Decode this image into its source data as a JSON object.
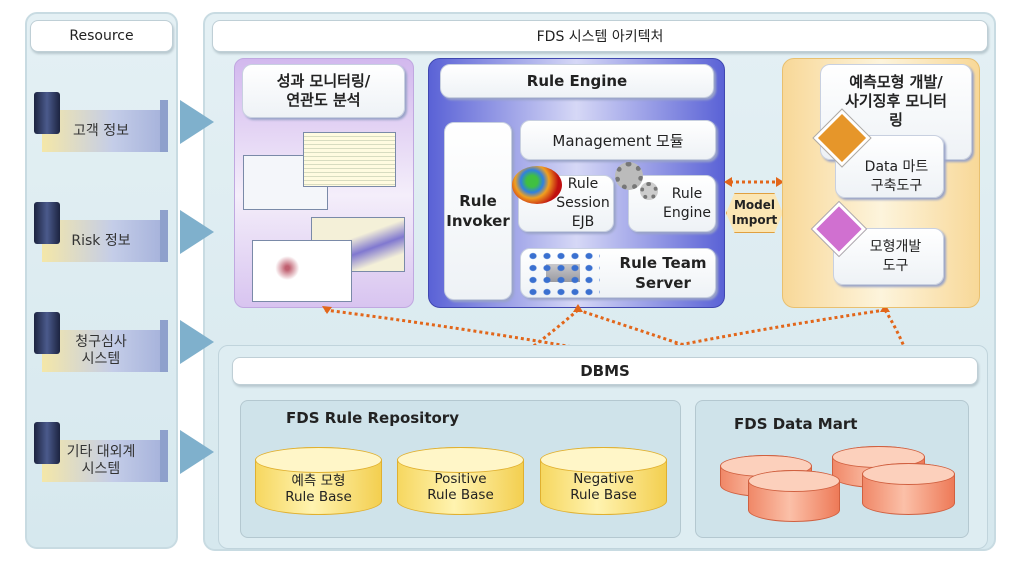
{
  "resource": {
    "title": "Resource",
    "items": [
      {
        "label": "고객 정보",
        "icon": "server-icon"
      },
      {
        "label": "Risk 정보",
        "icon": "server-icon"
      },
      {
        "label": "청구심사\n시스템",
        "icon": "server-icon"
      },
      {
        "label": "기타 대외계\n시스템",
        "icon": "server-icon"
      }
    ]
  },
  "main": {
    "title": "FDS 시스템 아키텍처"
  },
  "monitoring": {
    "title": "성과 모니터링/\n연관도 분석"
  },
  "rule_engine": {
    "title": "Rule Engine",
    "invoker": "Rule\nInvoker",
    "management": "Management 모듈",
    "session": "Rule\nSession\nEJB",
    "engine": "Rule\nEngine",
    "team_server": "Rule Team\nServer"
  },
  "model_import": "Model\nImport",
  "predict": {
    "title": "예측모형 개발/\n사기징후 모니터\n링",
    "datamart_tool": "Data 마트\n구축도구",
    "model_tool": "모형개발\n도구"
  },
  "dbms": {
    "title": "DBMS",
    "repository": {
      "title": "FDS Rule Repository",
      "bases": [
        "예측 모형\nRule Base",
        "Positive\nRule Base",
        "Negative\nRule Base"
      ]
    },
    "datamart": {
      "title": "FDS Data Mart"
    }
  },
  "colors": {
    "connector": "#e2661a",
    "monitoring_bg": "#dcc8f0",
    "engine_bg": "#6c74dc",
    "predict_bg": "#fbe2b0"
  }
}
